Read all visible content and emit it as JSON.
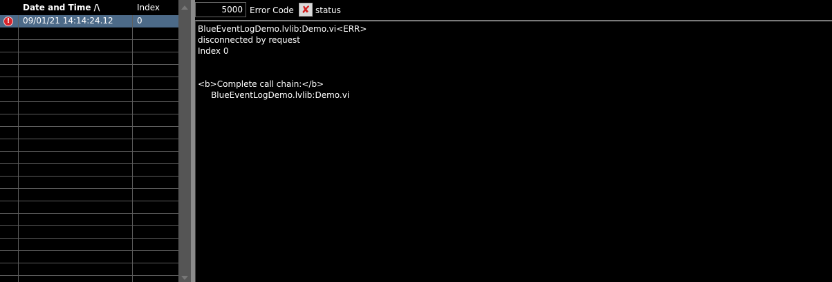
{
  "table": {
    "headers": {
      "date_time": "Date and Time  /\\",
      "index": "Index"
    },
    "rows": [
      {
        "icon": "error-icon",
        "date_time": "09/01/21 14:14:24.12",
        "index": "0",
        "selected": true
      }
    ],
    "empty_row_count": 20
  },
  "error_cluster": {
    "code_value": "5000",
    "code_label": "Error Code",
    "status_label": "status",
    "status_glyph": "✘",
    "status_icon": "red-x-icon",
    "source_lines": [
      "BlueEventLogDemo.lvlib:Demo.vi<ERR>",
      "disconnected by request",
      "Index 0",
      "",
      "",
      "<b>Complete call chain:</b>",
      "     BlueEventLogDemo.lvlib:Demo.vi"
    ]
  },
  "colors": {
    "selected_row": "#4c6a88",
    "error_red": "#d8232a",
    "background": "#000000",
    "grid_line": "#5f5f5f"
  }
}
